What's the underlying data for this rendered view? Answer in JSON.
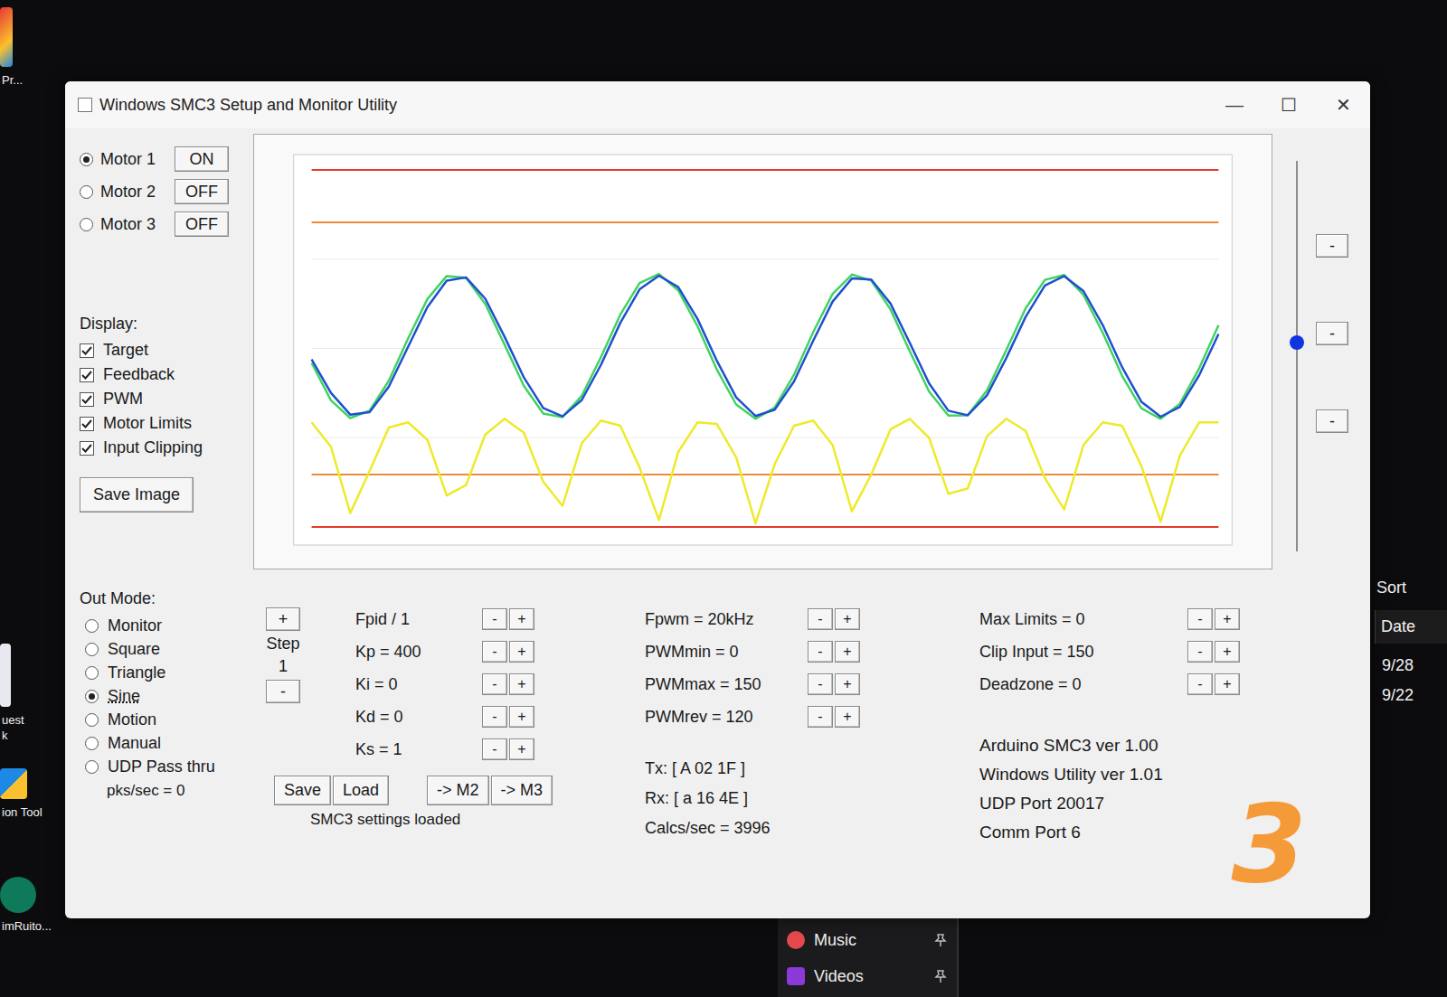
{
  "desktop": {
    "icons": [
      {
        "lines": [
          "Pr..."
        ]
      },
      {
        "lines": [
          "uest",
          "k"
        ]
      },
      {
        "lines": [
          "ion Tool"
        ]
      },
      {
        "lines": [
          "imRuito..."
        ]
      }
    ]
  },
  "side_panel": {
    "header": "Sort",
    "column": "Date",
    "rows": [
      "9/28",
      "9/22"
    ]
  },
  "start_menu": [
    {
      "label": "Music"
    },
    {
      "label": "Videos"
    }
  ],
  "window": {
    "title": "Windows SMC3 Setup and Monitor Utility",
    "controls": [
      "—",
      "☐",
      "✕"
    ]
  },
  "motors": [
    {
      "label": "Motor 1",
      "selected": true,
      "state": "ON"
    },
    {
      "label": "Motor 2",
      "selected": false,
      "state": "OFF"
    },
    {
      "label": "Motor 3",
      "selected": false,
      "state": "OFF"
    }
  ],
  "display": {
    "label": "Display:",
    "options": [
      {
        "label": "Target",
        "checked": true
      },
      {
        "label": "Feedback",
        "checked": true
      },
      {
        "label": "PWM",
        "checked": true
      },
      {
        "label": "Motor Limits",
        "checked": true
      },
      {
        "label": "Input Clipping",
        "checked": true
      }
    ]
  },
  "save_image": "Save Image",
  "chart": {
    "axis_max": 1023,
    "motor_limits": [
      0,
      1023
    ],
    "input_clipping": [
      150,
      873
    ],
    "series": [
      {
        "name": "Target",
        "color": "#3fd45e",
        "values": [
          470,
          363,
          312,
          333,
          419,
          540,
          653,
          719,
          714,
          639,
          522,
          404,
          325,
          315,
          376,
          487,
          609,
          699,
          725,
          678,
          575,
          451,
          351,
          310,
          342,
          436,
          559,
          668,
          723,
          706,
          623,
          503,
          388,
          319,
          320,
          391,
          507,
          626,
          708,
          722,
          665,
          556,
          433,
          340,
          310,
          353,
          455,
          578
        ]
      },
      {
        "name": "Feedback",
        "color": "#1f4fd0",
        "values": [
          480,
          384,
          322,
          329,
          402,
          516,
          630,
          706,
          715,
          654,
          545,
          428,
          341,
          317,
          364,
          465,
          585,
          681,
          720,
          687,
          596,
          476,
          371,
          318,
          336,
          417,
          534,
          646,
          712,
          709,
          640,
          527,
          411,
          333,
          320,
          377,
          484,
          602,
          692,
          719,
          676,
          578,
          458,
          359,
          316,
          344,
          435,
          553
        ]
      },
      {
        "name": "PWM",
        "color": "#eeea2a",
        "values": [
          300,
          230,
          40,
          160,
          285,
          300,
          250,
          90,
          120,
          265,
          310,
          270,
          130,
          60,
          240,
          305,
          290,
          170,
          20,
          215,
          300,
          295,
          200,
          10,
          180,
          290,
          305,
          235,
          45,
          150,
          280,
          310,
          255,
          95,
          110,
          260,
          310,
          275,
          140,
          50,
          235,
          300,
          290,
          175,
          15,
          205,
          300,
          300
        ]
      }
    ]
  },
  "slider": {
    "level": 0.52,
    "buttons": [
      "-",
      "-",
      "-"
    ]
  },
  "out_mode": {
    "label": "Out Mode:",
    "options": [
      {
        "label": "Monitor",
        "selected": false
      },
      {
        "label": "Square",
        "selected": false
      },
      {
        "label": "Triangle",
        "selected": false
      },
      {
        "label": "Sine",
        "selected": true
      },
      {
        "label": "Motion",
        "selected": false
      },
      {
        "label": "Manual",
        "selected": false
      },
      {
        "label": "UDP Pass thru",
        "selected": false
      }
    ],
    "rate": "pks/sec = 0"
  },
  "step": {
    "plus": "+",
    "label": "Step",
    "value": "1",
    "minus": "-"
  },
  "adjust_buttons": [
    "-",
    "+"
  ],
  "pid": [
    "Fpid / 1",
    "Kp = 400",
    "Ki = 0",
    "Kd = 0",
    "Ks = 1"
  ],
  "file_buttons": [
    "Save",
    "Load",
    "-> M2",
    "-> M3"
  ],
  "status": "SMC3 settings loaded",
  "pwm": [
    "Fpwm = 20kHz",
    "PWMmin = 0",
    "PWMmax = 150",
    "PWMrev = 120"
  ],
  "comms": [
    "Tx: [ A 02 1F ]",
    "Rx: [ a 16 4E ]",
    "Calcs/sec = 3996"
  ],
  "limits": [
    "Max Limits = 0",
    "Clip Input = 150",
    "Deadzone = 0"
  ],
  "info": [
    "Arduino SMC3 ver 1.00",
    "Windows Utility ver 1.01",
    "UDP Port 20017",
    "Comm Port 6"
  ],
  "annotation": "3"
}
